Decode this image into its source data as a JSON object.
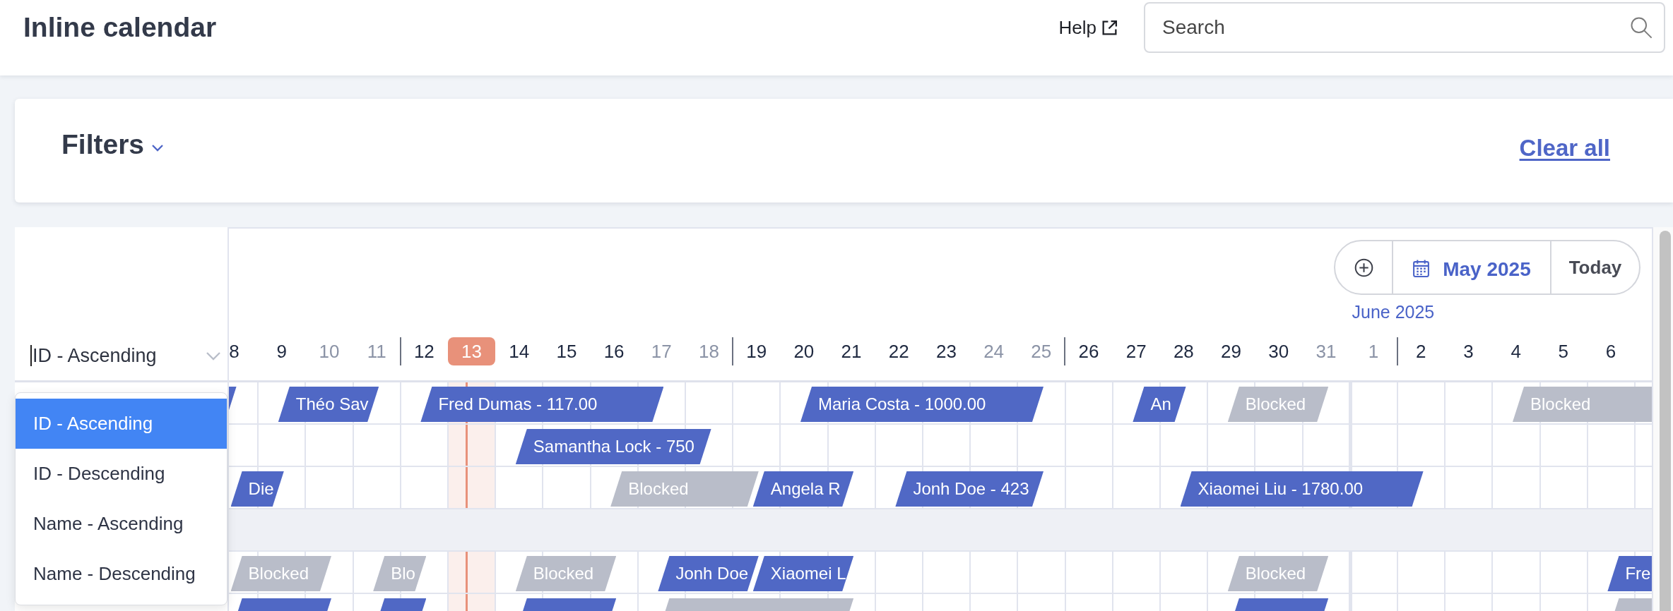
{
  "header": {
    "title": "Inline calendar",
    "help_link": "Help",
    "search": {
      "placeholder": "Search"
    }
  },
  "filters": {
    "title": "Filters",
    "expanded": false,
    "clear_all": "Clear all"
  },
  "sort": {
    "value": "ID - Ascending",
    "focused": true,
    "open": true,
    "options": [
      {
        "label": "ID - Ascending",
        "selected": true
      },
      {
        "label": "ID - Descending",
        "selected": false
      },
      {
        "label": "Name - Ascending",
        "selected": false
      },
      {
        "label": "Name - Descending",
        "selected": false
      }
    ]
  },
  "calendar": {
    "navigation": {
      "month": "May 2025",
      "today": "Today"
    },
    "days": [
      {
        "kind": "day",
        "label": "8",
        "weekend": false,
        "today": false
      },
      {
        "kind": "day",
        "label": "9",
        "weekend": false,
        "today": false
      },
      {
        "kind": "day",
        "label": "10",
        "weekend": true,
        "today": false
      },
      {
        "kind": "day",
        "label": "11",
        "weekend": true,
        "today": false
      },
      {
        "kind": "week_divider"
      },
      {
        "kind": "day",
        "label": "12",
        "weekend": false,
        "today": false
      },
      {
        "kind": "day",
        "label": "13",
        "weekend": false,
        "today": true
      },
      {
        "kind": "day",
        "label": "14",
        "weekend": false,
        "today": false
      },
      {
        "kind": "day",
        "label": "15",
        "weekend": false,
        "today": false
      },
      {
        "kind": "day",
        "label": "16",
        "weekend": false,
        "today": false
      },
      {
        "kind": "day",
        "label": "17",
        "weekend": true,
        "today": false
      },
      {
        "kind": "day",
        "label": "18",
        "weekend": true,
        "today": false
      },
      {
        "kind": "week_divider"
      },
      {
        "kind": "day",
        "label": "19",
        "weekend": false,
        "today": false
      },
      {
        "kind": "day",
        "label": "20",
        "weekend": false,
        "today": false
      },
      {
        "kind": "day",
        "label": "21",
        "weekend": false,
        "today": false
      },
      {
        "kind": "day",
        "label": "22",
        "weekend": false,
        "today": false
      },
      {
        "kind": "day",
        "label": "23",
        "weekend": false,
        "today": false
      },
      {
        "kind": "day",
        "label": "24",
        "weekend": true,
        "today": false
      },
      {
        "kind": "day",
        "label": "25",
        "weekend": true,
        "today": false
      },
      {
        "kind": "week_divider"
      },
      {
        "kind": "day",
        "label": "26",
        "weekend": false,
        "today": false
      },
      {
        "kind": "day",
        "label": "27",
        "weekend": false,
        "today": false
      },
      {
        "kind": "day",
        "label": "28",
        "weekend": false,
        "today": false
      },
      {
        "kind": "day",
        "label": "29",
        "weekend": false,
        "today": false
      },
      {
        "kind": "day",
        "label": "30",
        "weekend": false,
        "today": false
      },
      {
        "kind": "day",
        "label": "31",
        "weekend": true,
        "today": false
      },
      {
        "kind": "day",
        "label": "1",
        "weekend": true,
        "today": false,
        "month_label": "June 2025"
      },
      {
        "kind": "week_divider"
      },
      {
        "kind": "day",
        "label": "2",
        "weekend": false,
        "today": false
      },
      {
        "kind": "day",
        "label": "3",
        "weekend": false,
        "today": false
      },
      {
        "kind": "day",
        "label": "4",
        "weekend": false,
        "today": false
      },
      {
        "kind": "day",
        "label": "5",
        "weekend": false,
        "today": false
      },
      {
        "kind": "day",
        "label": "6",
        "weekend": false,
        "today": false
      }
    ],
    "rows": [
      {
        "kind": "unit",
        "nights": [
          {
            "kind": "booking"
          },
          {
            "kind": "free"
          },
          {
            "kind": "booking",
            "label": "Théo Sav"
          },
          {
            "kind": "continued"
          },
          {
            "kind": "free"
          },
          {
            "kind": "booking",
            "label": "Fred Dumas - 117.00"
          },
          {
            "kind": "continued"
          },
          {
            "kind": "continued"
          },
          {
            "kind": "continued"
          },
          {
            "kind": "continued"
          },
          {
            "kind": "free"
          },
          {
            "kind": "free"
          },
          {
            "kind": "free"
          },
          {
            "kind": "booking",
            "label": "Maria Costa - 1000.00"
          },
          {
            "kind": "continued"
          },
          {
            "kind": "continued"
          },
          {
            "kind": "continued"
          },
          {
            "kind": "continued"
          },
          {
            "kind": "free"
          },
          {
            "kind": "free"
          },
          {
            "kind": "booking",
            "label": "An"
          },
          {
            "kind": "free"
          },
          {
            "kind": "blocked",
            "label": "Blocked"
          },
          {
            "kind": "continued"
          },
          {
            "kind": "free"
          },
          {
            "kind": "free"
          },
          {
            "kind": "free"
          },
          {
            "kind": "free"
          },
          {
            "kind": "blocked",
            "label": "Blocked"
          },
          {
            "kind": "continued"
          },
          {
            "kind": "continued"
          }
        ]
      },
      {
        "kind": "unit",
        "nights": [
          {
            "kind": "free"
          },
          {
            "kind": "free"
          },
          {
            "kind": "free"
          },
          {
            "kind": "free"
          },
          {
            "kind": "free"
          },
          {
            "kind": "free"
          },
          {
            "kind": "free"
          },
          {
            "kind": "booking",
            "label": "Samantha Lock - 750"
          },
          {
            "kind": "continued"
          },
          {
            "kind": "continued"
          },
          {
            "kind": "continued"
          },
          {
            "kind": "free"
          },
          {
            "kind": "free"
          },
          {
            "kind": "free"
          },
          {
            "kind": "free"
          },
          {
            "kind": "free"
          },
          {
            "kind": "free"
          },
          {
            "kind": "free"
          },
          {
            "kind": "free"
          },
          {
            "kind": "free"
          },
          {
            "kind": "free"
          },
          {
            "kind": "free"
          },
          {
            "kind": "free"
          },
          {
            "kind": "free"
          },
          {
            "kind": "free"
          },
          {
            "kind": "free"
          },
          {
            "kind": "free"
          },
          {
            "kind": "free"
          },
          {
            "kind": "free"
          },
          {
            "kind": "free"
          },
          {
            "kind": "free"
          }
        ]
      },
      {
        "kind": "unit",
        "nights": [
          {
            "kind": "free"
          },
          {
            "kind": "booking",
            "label": "Die"
          },
          {
            "kind": "free"
          },
          {
            "kind": "free"
          },
          {
            "kind": "free"
          },
          {
            "kind": "free"
          },
          {
            "kind": "free"
          },
          {
            "kind": "free"
          },
          {
            "kind": "free"
          },
          {
            "kind": "blocked",
            "label": "Blocked"
          },
          {
            "kind": "continued"
          },
          {
            "kind": "continued"
          },
          {
            "kind": "booking",
            "label": "Angela R"
          },
          {
            "kind": "continued"
          },
          {
            "kind": "free"
          },
          {
            "kind": "booking",
            "label": "Jonh Doe - 423"
          },
          {
            "kind": "continued"
          },
          {
            "kind": "continued"
          },
          {
            "kind": "free"
          },
          {
            "kind": "free"
          },
          {
            "kind": "free"
          },
          {
            "kind": "booking",
            "label": "Xiaomei Liu - 1780.00"
          },
          {
            "kind": "continued"
          },
          {
            "kind": "continued"
          },
          {
            "kind": "continued"
          },
          {
            "kind": "continued"
          },
          {
            "kind": "free"
          },
          {
            "kind": "free"
          },
          {
            "kind": "free"
          },
          {
            "kind": "free"
          },
          {
            "kind": "free"
          }
        ]
      },
      {
        "kind": "group"
      },
      {
        "kind": "unit",
        "nights": [
          {
            "kind": "free"
          },
          {
            "kind": "blocked",
            "label": "Blocked"
          },
          {
            "kind": "continued"
          },
          {
            "kind": "free"
          },
          {
            "kind": "blocked",
            "label": "Blo"
          },
          {
            "kind": "free"
          },
          {
            "kind": "free"
          },
          {
            "kind": "blocked",
            "label": "Blocked"
          },
          {
            "kind": "continued"
          },
          {
            "kind": "free"
          },
          {
            "kind": "booking",
            "label": "Jonh Doe"
          },
          {
            "kind": "continued"
          },
          {
            "kind": "booking",
            "label": "Xiaomei L"
          },
          {
            "kind": "continued"
          },
          {
            "kind": "free"
          },
          {
            "kind": "free"
          },
          {
            "kind": "free"
          },
          {
            "kind": "free"
          },
          {
            "kind": "free"
          },
          {
            "kind": "free"
          },
          {
            "kind": "free"
          },
          {
            "kind": "free"
          },
          {
            "kind": "blocked",
            "label": "Blocked"
          },
          {
            "kind": "continued"
          },
          {
            "kind": "free"
          },
          {
            "kind": "free"
          },
          {
            "kind": "free"
          },
          {
            "kind": "free"
          },
          {
            "kind": "free"
          },
          {
            "kind": "free"
          },
          {
            "kind": "booking",
            "label": "Fre"
          }
        ]
      },
      {
        "kind": "unit",
        "nights": [
          {
            "kind": "free"
          },
          {
            "kind": "booking"
          },
          {
            "kind": "continued"
          },
          {
            "kind": "free"
          },
          {
            "kind": "booking"
          },
          {
            "kind": "free"
          },
          {
            "kind": "free"
          },
          {
            "kind": "booking"
          },
          {
            "kind": "continued"
          },
          {
            "kind": "free"
          },
          {
            "kind": "blocked"
          },
          {
            "kind": "continued"
          },
          {
            "kind": "continued"
          },
          {
            "kind": "continued"
          },
          {
            "kind": "free"
          },
          {
            "kind": "free"
          },
          {
            "kind": "free"
          },
          {
            "kind": "free"
          },
          {
            "kind": "free"
          },
          {
            "kind": "free"
          },
          {
            "kind": "free"
          },
          {
            "kind": "free"
          },
          {
            "kind": "booking"
          },
          {
            "kind": "continued"
          },
          {
            "kind": "free"
          },
          {
            "kind": "free"
          },
          {
            "kind": "free"
          },
          {
            "kind": "free"
          },
          {
            "kind": "free"
          },
          {
            "kind": "free"
          },
          {
            "kind": "blocked"
          }
        ]
      }
    ]
  }
}
